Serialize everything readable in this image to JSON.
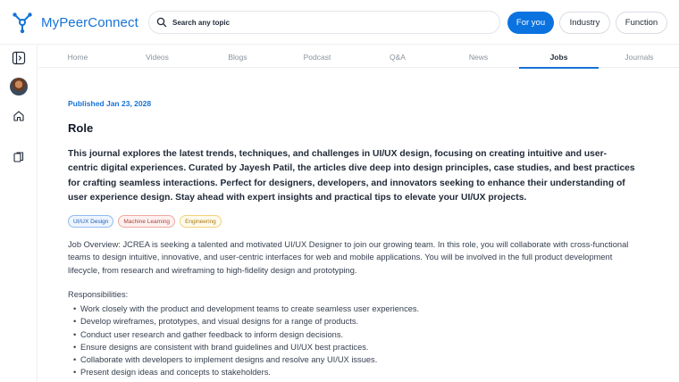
{
  "app": {
    "name": "MyPeerConnect"
  },
  "search": {
    "placeholder": "Search any topic"
  },
  "header": {
    "filters": [
      "For you",
      "Industry",
      "Function"
    ]
  },
  "nav": {
    "tabs": [
      "Home",
      "Videos",
      "Blogs",
      "Podcast",
      "Q&A",
      "News",
      "Jobs",
      "Journals"
    ],
    "active": "Jobs"
  },
  "article": {
    "published": "Published Jan 23, 2028",
    "title": "Role",
    "summary": "This journal explores the latest trends, techniques, and challenges in UI/UX design, focusing on creating intuitive and user-centric digital experiences. Curated by Jayesh Patil, the articles dive deep into design principles, case studies, and best practices for crafting seamless interactions. Perfect for designers, developers, and innovators seeking to enhance their understanding of user experience design. Stay ahead with expert insights and practical tips to elevate your UI/UX projects.",
    "tags": [
      "UI/UX Design",
      "Machine Learning",
      "Engineering"
    ],
    "overview": "Job Overview: JCREA is seeking a talented and motivated UI/UX Designer to join our growing team. In this role, you will collaborate with cross-functional teams to design intuitive, innovative, and user-centric interfaces for web and mobile applications. You will be involved in the full product development lifecycle, from research and wireframing to high-fidelity design and prototyping.",
    "responsibilities_title": "Responsibilities:",
    "responsibilities": [
      "Work closely with the product and development teams to create seamless user experiences.",
      "Develop wireframes, prototypes, and visual designs for a range of products.",
      "Conduct user research and gather feedback to inform design decisions.",
      "Ensure designs are consistent with brand guidelines and UI/UX best practices.",
      "Collaborate with developers to implement designs and resolve any UI/UX issues.",
      "Present design ideas and concepts to stakeholders."
    ]
  },
  "colors": {
    "brand": "#1673d6",
    "active_pill": "#0b73e0"
  },
  "icons": {
    "logo": "peer-network-logo-icon",
    "search": "search-icon",
    "sidebar_toggle": "sidebar-toggle-icon",
    "home": "home-icon",
    "library": "library-icon"
  }
}
